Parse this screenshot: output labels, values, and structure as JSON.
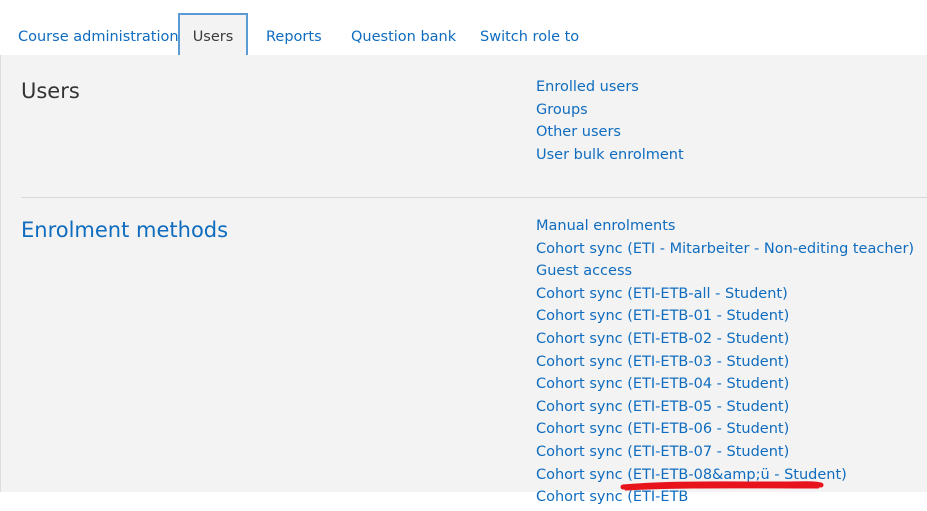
{
  "tabs": [
    {
      "label": "Course administration",
      "active": false
    },
    {
      "label": "Users",
      "active": true
    },
    {
      "label": "Reports",
      "active": false
    },
    {
      "label": "Question bank",
      "active": false
    },
    {
      "label": "Switch role to",
      "active": false
    }
  ],
  "sections": {
    "users": {
      "title": "Users",
      "links": [
        "Enrolled users",
        "Groups",
        "Other users",
        "User bulk enrolment"
      ]
    },
    "enrolment": {
      "title": "Enrolment methods",
      "links": [
        "Manual enrolments",
        "Cohort sync (ETI - Mitarbeiter - Non-editing teacher)",
        "Guest access",
        "Cohort sync (ETI-ETB-all - Student)",
        "Cohort sync (ETI-ETB-01 - Student)",
        "Cohort sync (ETI-ETB-02 - Student)",
        "Cohort sync (ETI-ETB-03 - Student)",
        "Cohort sync (ETI-ETB-04 - Student)",
        "Cohort sync (ETI-ETB-05 - Student)",
        "Cohort sync (ETI-ETB-06 - Student)",
        "Cohort sync (ETI-ETB-07 - Student)",
        "Cohort sync (ETI-ETB-08&amp;ü - Student)",
        "Cohort sync (ETI-ETB"
      ]
    }
  },
  "colors": {
    "link": "#0f6cbf",
    "panel_background": "#f3f3f3",
    "active_tab_border": "#5a9bd3",
    "annotation_mark": "#e8141c"
  }
}
